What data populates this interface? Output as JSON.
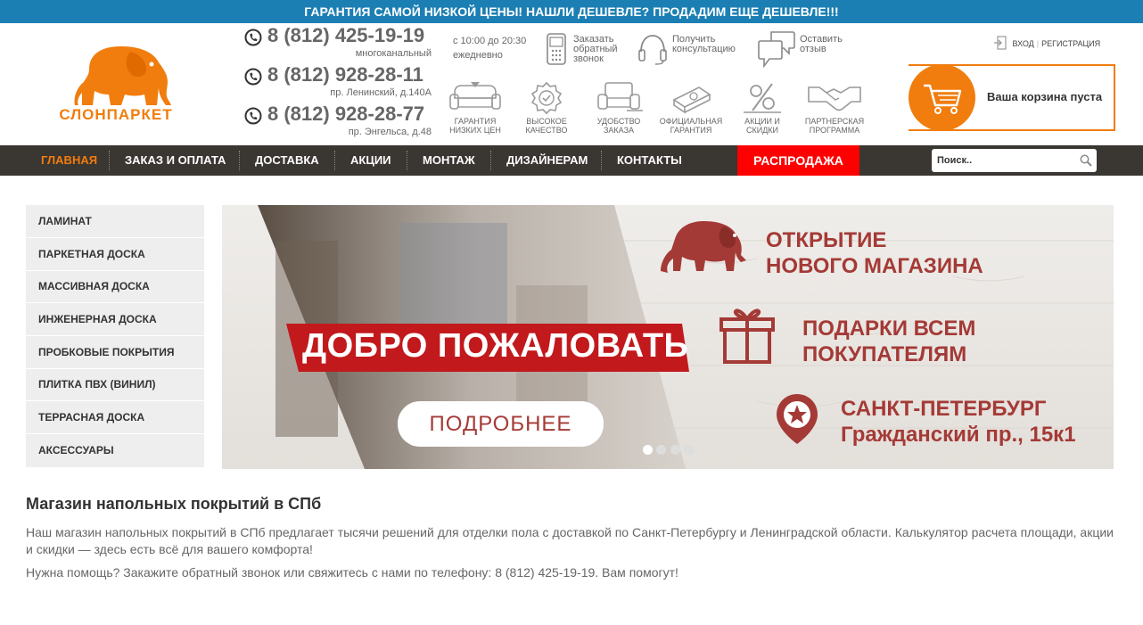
{
  "topbar": {
    "text": "ГАРАНТИЯ САМОЙ НИЗКОЙ ЦЕНЫ! НАШЛИ ДЕШЕВЛЕ? ПРОДАДИМ ЕЩЕ ДЕШЕВЛЕ!!!"
  },
  "logo": {
    "text": "СЛОНПАРКЕТ",
    "color": "#f07d0e"
  },
  "phones": [
    {
      "number": "8 (812) 425-19-19",
      "sub": "многоканальный"
    },
    {
      "number": "8 (812) 928-28-11",
      "sub": "пр. Ленинский, д.140А"
    },
    {
      "number": "8 (812) 928-28-77",
      "sub": "пр. Энгельса, д.48"
    }
  ],
  "hours": {
    "time": "с 10:00 до 20:30",
    "days": "ежедневно"
  },
  "contact_links": {
    "callback": "Заказать\nобратный\nзвонок",
    "consult": "Получить\nконсультацию",
    "review": "Оставить\nотзыв"
  },
  "features": [
    {
      "label": "Гарантия\nнизких цен",
      "icon": "sofa-icon"
    },
    {
      "label": "Высокое\nкачество",
      "icon": "quality-badge-icon"
    },
    {
      "label": "Удобство\nзаказа",
      "icon": "armchair-icon"
    },
    {
      "label": "Официальная\nгарантия",
      "icon": "document-icon"
    },
    {
      "label": "Акции и\nскидки",
      "icon": "percent-icon"
    },
    {
      "label": "Партнерская\nпрограмма",
      "icon": "handshake-icon"
    }
  ],
  "auth": {
    "login": "ВХОД",
    "register": "РЕГИСТРАЦИЯ"
  },
  "cart": {
    "text": "Ваша корзина пуста"
  },
  "nav": {
    "items": [
      "Главная",
      "Заказ и оплата",
      "Доставка",
      "Акции",
      "Монтаж",
      "Дизайнерам",
      "Контакты"
    ],
    "sale": "РАСПРОДАЖА"
  },
  "search": {
    "placeholder": "Поиск.."
  },
  "sidebar": {
    "items": [
      "Ламинат",
      "Паркетная доска",
      "Массивная доска",
      "Инженерная доска",
      "Пробковые покрытия",
      "Плитка ПВХ (винил)",
      "Террасная доска",
      "Аксессуары"
    ]
  },
  "banner": {
    "welcome": "ДОБРО ПОЖАЛОВАТЬ",
    "button": "ПОДРОБНЕЕ",
    "line1": "ОТКРЫТИЕ\nНОВОГО МАГАЗИНА",
    "line2": "ПОДАРКИ ВСЕМ\nПОКУПАТЕЛЯМ",
    "line3": "САНКТ-ПЕТЕРБУРГ\nГражданский пр., 15к1",
    "slides": 4,
    "active_slide": 1,
    "accent": "#c2191c",
    "text_color": "#a43a36"
  },
  "content": {
    "title": "Магазин напольных покрытий в СПб",
    "p1": "Наш магазин напольных покрытий в СПб предлагает тысячи решений для отделки пола с доставкой по Санкт-Петербургу и Ленинградской области. Калькулятор расчета площади, акции и скидки — здесь есть всё для вашего комфорта!",
    "p2": "Нужна помощь? Закажите обратный звонок или свяжитесь с нами по телефону: 8 (812) 425-19-19. Вам помогут!"
  },
  "colors": {
    "brand": "#f07d0e",
    "topbar": "#1c7fb3",
    "nav": "#3a3632",
    "sale": "#ff0000"
  }
}
